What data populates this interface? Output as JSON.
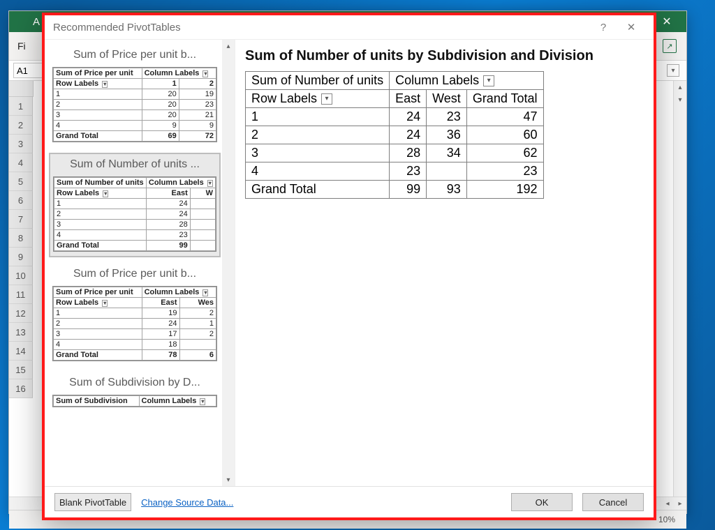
{
  "excel": {
    "file_tab": "Fi",
    "app_letter": "A",
    "close_x": "✕",
    "name_box": "A1",
    "zoom": "10%",
    "row_headers": [
      "1",
      "2",
      "3",
      "4",
      "5",
      "6",
      "7",
      "8",
      "9",
      "10",
      "11",
      "12",
      "13",
      "14",
      "15",
      "16"
    ]
  },
  "dialog": {
    "title": "Recommended PivotTables",
    "help": "?",
    "close": "✕",
    "blank_btn": "Blank PivotTable",
    "change_src": "Change Source Data...",
    "ok": "OK",
    "cancel": "Cancel",
    "thumbs": [
      {
        "caption": "Sum of Price per unit b...",
        "measure": "Sum of Price per unit",
        "col_label": "Column Labels",
        "row_label": "Row Labels",
        "cols": [
          "1",
          "2"
        ],
        "rows": [
          {
            "k": "1",
            "v": [
              "20",
              "19"
            ]
          },
          {
            "k": "2",
            "v": [
              "20",
              "23"
            ]
          },
          {
            "k": "3",
            "v": [
              "20",
              "21"
            ]
          },
          {
            "k": "4",
            "v": [
              "9",
              "9"
            ]
          }
        ],
        "total": {
          "k": "Grand Total",
          "v": [
            "69",
            "72"
          ]
        }
      },
      {
        "caption": "Sum of Number of units ...",
        "measure": "Sum of Number of units",
        "col_label": "Column Labels",
        "row_label": "Row Labels",
        "cols": [
          "East",
          "W"
        ],
        "rows": [
          {
            "k": "1",
            "v": [
              "24",
              ""
            ]
          },
          {
            "k": "2",
            "v": [
              "24",
              ""
            ]
          },
          {
            "k": "3",
            "v": [
              "28",
              ""
            ]
          },
          {
            "k": "4",
            "v": [
              "23",
              ""
            ]
          }
        ],
        "total": {
          "k": "Grand Total",
          "v": [
            "99",
            ""
          ]
        }
      },
      {
        "caption": "Sum of Price per unit b...",
        "measure": "Sum of Price per unit",
        "col_label": "Column Labels",
        "row_label": "Row Labels",
        "cols": [
          "East",
          "Wes"
        ],
        "rows": [
          {
            "k": "1",
            "v": [
              "19",
              "2"
            ]
          },
          {
            "k": "2",
            "v": [
              "24",
              "1"
            ]
          },
          {
            "k": "3",
            "v": [
              "17",
              "2"
            ]
          },
          {
            "k": "4",
            "v": [
              "18",
              ""
            ]
          }
        ],
        "total": {
          "k": "Grand Total",
          "v": [
            "78",
            "6"
          ]
        }
      },
      {
        "caption": "Sum of Subdivision by D...",
        "measure": "Sum of Subdivision",
        "col_label": "Column Labels",
        "row_label": "",
        "cols": [],
        "rows": [],
        "total": {
          "k": "",
          "v": []
        }
      }
    ],
    "preview": {
      "title": "Sum of Number of units by Subdivision and Division",
      "measure": "Sum of Number of units",
      "col_label": "Column Labels",
      "row_label": "Row Labels",
      "cols": [
        "East",
        "West",
        "Grand Total"
      ],
      "rows": [
        {
          "k": "1",
          "v": [
            "24",
            "23",
            "47"
          ]
        },
        {
          "k": "2",
          "v": [
            "24",
            "36",
            "60"
          ]
        },
        {
          "k": "3",
          "v": [
            "28",
            "34",
            "62"
          ]
        },
        {
          "k": "4",
          "v": [
            "23",
            "",
            "23"
          ]
        }
      ],
      "total": {
        "k": "Grand Total",
        "v": [
          "99",
          "93",
          "192"
        ]
      }
    }
  },
  "chart_data": {
    "type": "table",
    "title": "Sum of Number of units by Subdivision and Division",
    "row_field": "Subdivision",
    "column_field": "Division",
    "columns": [
      "East",
      "West"
    ],
    "rows": [
      {
        "label": "1",
        "East": 24,
        "West": 23,
        "total": 47
      },
      {
        "label": "2",
        "East": 24,
        "West": 36,
        "total": 60
      },
      {
        "label": "3",
        "East": 28,
        "West": 34,
        "total": 62
      },
      {
        "label": "4",
        "East": 23,
        "West": null,
        "total": 23
      }
    ],
    "grand_total": {
      "East": 99,
      "West": 93,
      "total": 192
    }
  }
}
